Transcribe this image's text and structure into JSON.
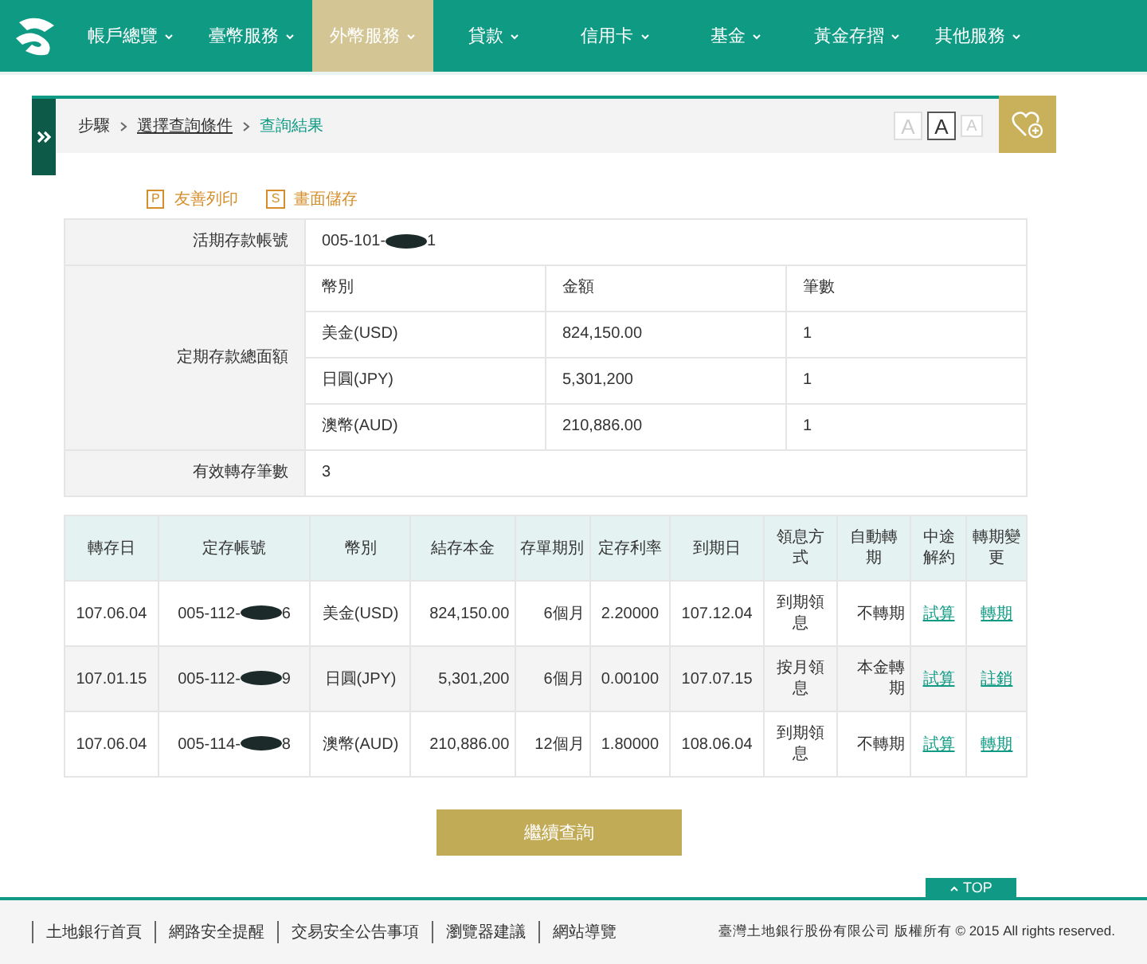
{
  "nav": [
    {
      "label": "帳戶總覽",
      "selected": false
    },
    {
      "label": "臺幣服務",
      "selected": false
    },
    {
      "label": "外幣服務",
      "selected": true
    },
    {
      "label": "貸款",
      "selected": false
    },
    {
      "label": "信用卡",
      "selected": false
    },
    {
      "label": "基金",
      "selected": false
    },
    {
      "label": "黃金存摺",
      "selected": false
    },
    {
      "label": "其他服務",
      "selected": false
    }
  ],
  "breadcrumb": {
    "label": "步驟",
    "items": [
      {
        "text": "選擇查詢條件",
        "current": false
      },
      {
        "text": "查詢結果",
        "current": true
      }
    ]
  },
  "font_sizes": [
    {
      "label": "A",
      "selected": false
    },
    {
      "label": "A",
      "selected": true
    },
    {
      "label": "A",
      "selected": false
    }
  ],
  "actions": [
    {
      "key": "P",
      "label": "友善列印"
    },
    {
      "key": "S",
      "label": "畫面儲存"
    }
  ],
  "summary": {
    "account_label": "活期存款帳號",
    "account": {
      "prefix": "005-101-",
      "suffix": "1"
    },
    "total_label": "定期存款總面額",
    "columns": [
      "幣別",
      "金額",
      "筆數"
    ],
    "rows": [
      {
        "currency": "美金(USD)",
        "amount": "824,150.00",
        "count": "1"
      },
      {
        "currency": "日圓(JPY)",
        "amount": "5,301,200",
        "count": "1"
      },
      {
        "currency": "澳幣(AUD)",
        "amount": "210,886.00",
        "count": "1"
      }
    ],
    "valid_label": "有效轉存筆數",
    "valid": "3"
  },
  "table": {
    "columns": [
      "轉存日",
      "定存帳號",
      "幣別",
      "結存本金",
      "存單期別",
      "定存利率",
      "到期日",
      "領息方式",
      "自動轉期",
      "中途解約",
      "轉期變更"
    ],
    "rows": [
      {
        "date": "107.06.04",
        "account": {
          "prefix": "005-112-",
          "suffix": "6"
        },
        "currency": "美金(USD)",
        "principal": "824,150.00",
        "term": "6個月",
        "rate": "2.20000",
        "maturity": "107.12.04",
        "interest": "到期領息",
        "auto": "不轉期",
        "cancel": "試算",
        "change": "轉期"
      },
      {
        "date": "107.01.15",
        "account": {
          "prefix": "005-112-",
          "suffix": "9"
        },
        "currency": "日圓(JPY)",
        "principal": "5,301,200",
        "term": "6個月",
        "rate": "0.00100",
        "maturity": "107.07.15",
        "interest": "按月領息",
        "auto": "本金轉期",
        "cancel": "試算",
        "change": "註銷"
      },
      {
        "date": "107.06.04",
        "account": {
          "prefix": "005-114-",
          "suffix": "8"
        },
        "currency": "澳幣(AUD)",
        "principal": "210,886.00",
        "term": "12個月",
        "rate": "1.80000",
        "maturity": "108.06.04",
        "interest": "到期領息",
        "auto": "不轉期",
        "cancel": "試算",
        "change": "轉期"
      }
    ]
  },
  "continue_button": "繼續查詢",
  "top_button": "TOP",
  "footer": {
    "links": [
      "土地銀行首頁",
      "網路安全提醒",
      "交易安全公告事項",
      "瀏覽器建議",
      "網站導覽"
    ],
    "copyright": "臺灣土地銀行股份有限公司 版權所有 © 2015 All rights reserved."
  }
}
